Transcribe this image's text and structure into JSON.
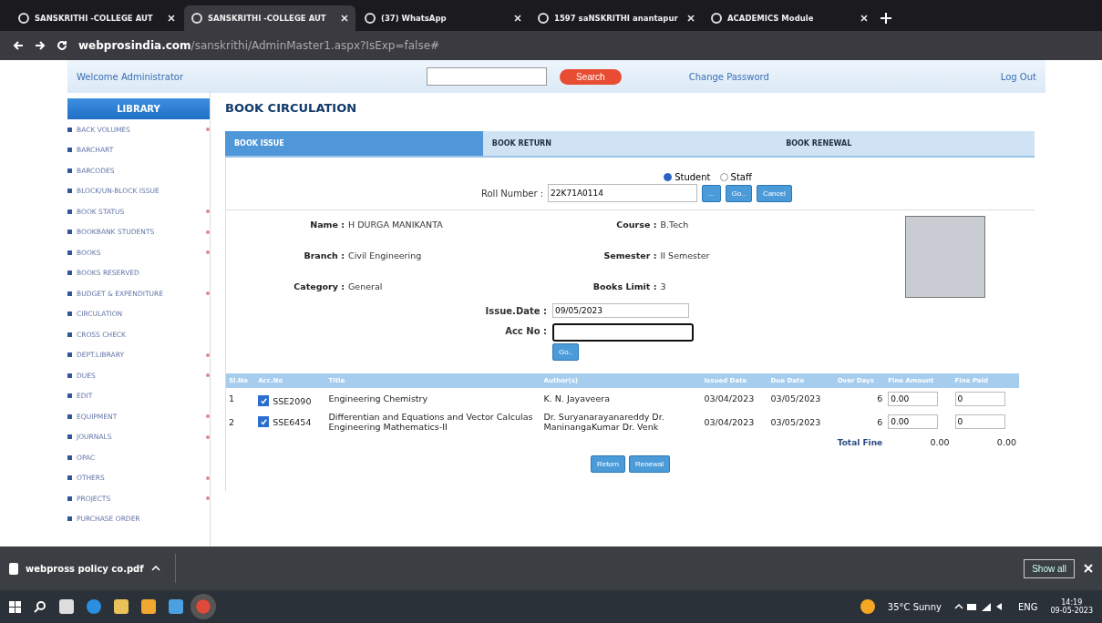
{
  "browser": {
    "tabs": [
      {
        "title": "SANSKRITHI -COLLEGE AUT",
        "selected": false
      },
      {
        "title": "SANSKRITHI -COLLEGE AUT",
        "selected": true
      },
      {
        "title": "(37) WhatsApp",
        "selected": false
      },
      {
        "title": "1597 saNSKRITHI anantapur",
        "selected": false
      },
      {
        "title": "ACADEMICS Module",
        "selected": false
      }
    ],
    "url_host": "webprosindia.com",
    "url_path": "/sanskrithi/AdminMaster1.aspx?IsExp=false#"
  },
  "header": {
    "welcome": "Welcome Administrator",
    "search_button": "Search",
    "change_password": "Change Password",
    "logout": "Log Out"
  },
  "sidebar": {
    "title": "LIBRARY",
    "items": [
      {
        "label": "BACK VOLUMES",
        "submenu": true
      },
      {
        "label": "BARCHART",
        "submenu": false
      },
      {
        "label": "BARCODES",
        "submenu": false
      },
      {
        "label": "BLOCK/UN-BLOCK ISSUE",
        "submenu": false
      },
      {
        "label": "BOOK STATUS",
        "submenu": true
      },
      {
        "label": "BOOKBANK STUDENTS",
        "submenu": true
      },
      {
        "label": "BOOKS",
        "submenu": true
      },
      {
        "label": "BOOKS RESERVED",
        "submenu": false
      },
      {
        "label": "BUDGET & EXPENDITURE",
        "submenu": true
      },
      {
        "label": "CIRCULATION",
        "submenu": false
      },
      {
        "label": "CROSS CHECK",
        "submenu": false
      },
      {
        "label": "DEPT.LIBRARY",
        "submenu": true
      },
      {
        "label": "DUES",
        "submenu": true
      },
      {
        "label": "EDIT",
        "submenu": false
      },
      {
        "label": "EQUIPMENT",
        "submenu": true
      },
      {
        "label": "JOURNALS",
        "submenu": true
      },
      {
        "label": "OPAC",
        "submenu": false
      },
      {
        "label": "OTHERS",
        "submenu": true
      },
      {
        "label": "PROJECTS",
        "submenu": true
      },
      {
        "label": "PURCHASE ORDER",
        "submenu": false
      }
    ]
  },
  "page_title": "BOOK CIRCULATION",
  "tabs": [
    {
      "label": "BOOK ISSUE",
      "selected": true
    },
    {
      "label": "BOOK RETURN",
      "selected": false
    },
    {
      "label": "BOOK RENEWAL",
      "selected": false
    }
  ],
  "member_type": [
    {
      "label": "Student",
      "selected": true
    },
    {
      "label": "Staff",
      "selected": false
    }
  ],
  "roll_number": {
    "label": "Roll Number :",
    "value": "22K71A0114",
    "buttons": [
      "...",
      "Go..",
      "Cancel"
    ]
  },
  "details": [
    {
      "label": "Name :",
      "value": "H DURGA MANIKANTA"
    },
    {
      "label": "Course :",
      "value": "B.Tech"
    },
    {
      "label": "Branch :",
      "value": "Civil Engineering"
    },
    {
      "label": "Semester :",
      "value": "II Semester"
    },
    {
      "label": "Category :",
      "value": "General"
    },
    {
      "label": "Books Limit :",
      "value": "3"
    }
  ],
  "issue_date": {
    "label": "Issue.Date :",
    "value": "09/05/2023"
  },
  "acc_no": {
    "label": "Acc No :",
    "button": "Go.."
  },
  "table": {
    "columns": [
      "Sl.No",
      "Acc.No",
      "Title",
      "Author(s)",
      "Issued Date",
      "Due Date",
      "Over Days",
      "Fine Amount",
      "Fine Paid"
    ],
    "rows": [
      {
        "sl": "1",
        "checked": true,
        "acc": "SSE2090",
        "title": "Engineering Chemistry",
        "author": "K. N. Jayaveera",
        "issued": "03/04/2023",
        "due": "03/05/2023",
        "days": "6",
        "fine": "0.00",
        "paid": "0"
      },
      {
        "sl": "2",
        "checked": true,
        "acc": "SSE6454",
        "title": "Differentian and Equations and Vector Calculas Engineering Mathematics-II",
        "author": "Dr. Suryanarayanareddy Dr. ManinangaKumar Dr. Venk",
        "issued": "03/04/2023",
        "due": "03/05/2023",
        "days": "6",
        "fine": "0.00",
        "paid": "0"
      }
    ],
    "total_label": "Total Fine",
    "total_fine": "0.00",
    "total_paid": "0.00"
  },
  "actions": [
    "Return",
    "Renewal"
  ],
  "download": {
    "file": "webpross policy co.pdf",
    "show_all": "Show all"
  },
  "taskbar": {
    "weather": "35°C Sunny",
    "lang": "ENG",
    "time": "14:19",
    "date": "09-05-2023"
  }
}
